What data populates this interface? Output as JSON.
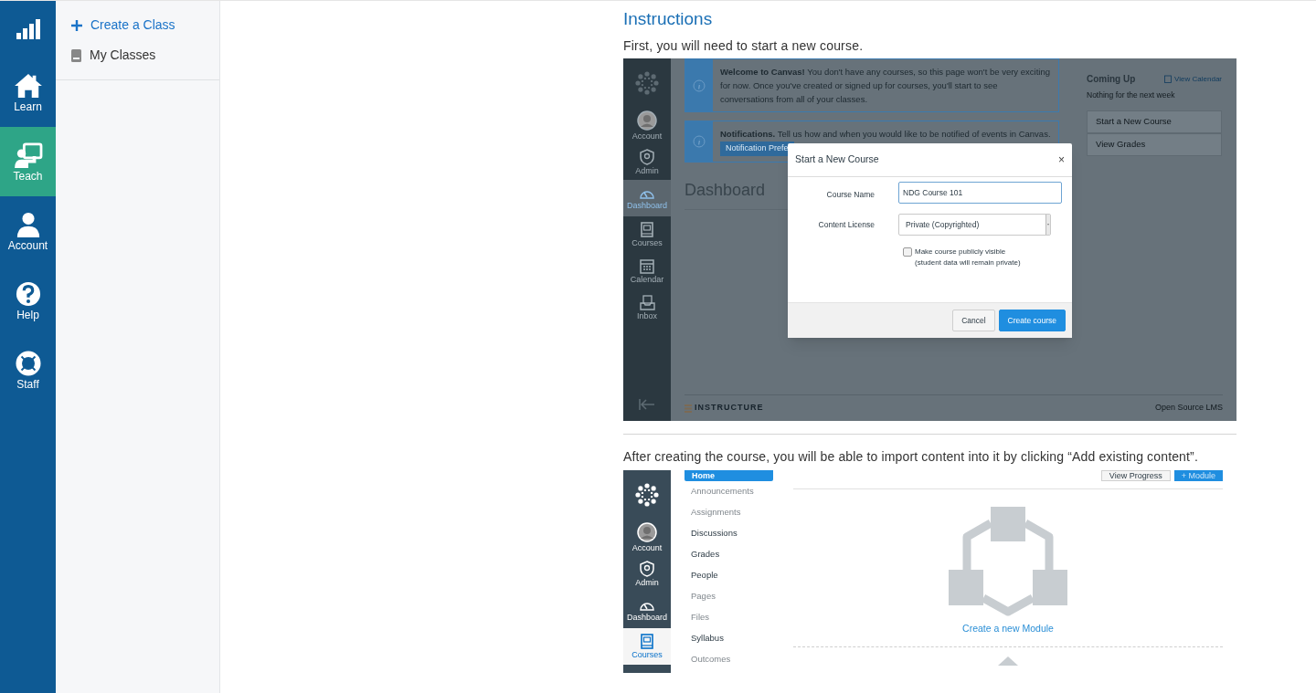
{
  "rail": {
    "items": [
      {
        "label": "Learn",
        "kind": "home",
        "selected": false
      },
      {
        "label": "Teach",
        "kind": "teach",
        "selected": true
      },
      {
        "label": "Account",
        "kind": "user",
        "selected": false
      },
      {
        "label": "Help",
        "kind": "help",
        "selected": false
      },
      {
        "label": "Staff",
        "kind": "lifebuoy",
        "selected": false
      }
    ]
  },
  "sidebar": {
    "items": [
      {
        "label": "Create a Class",
        "kind": "add"
      },
      {
        "label": "My Classes",
        "kind": "book"
      }
    ]
  },
  "content": {
    "heading": "Instructions",
    "intro": "First, you will need to start a new course.",
    "figure_1": {
      "nav": [
        {
          "kind": "logo"
        },
        {
          "label": "Account",
          "kind": "account",
          "selected": false
        },
        {
          "label": "Admin",
          "kind": "admin",
          "selected": false
        },
        {
          "label": "Dashboard",
          "kind": "dashboard",
          "selected": true
        },
        {
          "label": "Courses",
          "kind": "courses",
          "selected": false
        },
        {
          "label": "Calendar",
          "kind": "calendar",
          "selected": false
        },
        {
          "label": "Inbox",
          "kind": "inbox",
          "selected": false
        }
      ],
      "alerts": [
        {
          "text": "**Welcome to Canvas!**  You don't have any courses, so this page won't be very exciting for now. Once you've created or signed up for courses, you'll start to see conversations from all of your classes."
        },
        {
          "text": "**Notifications.**  Tell us how and when you would like to be notified of events in Canvas.",
          "button": "Notification Prefe"
        }
      ],
      "heading": "Dashboard",
      "coming_up": {
        "title": "Coming Up",
        "link": "View Calendar",
        "note": "Nothing for the next week"
      },
      "actions": [
        "Start a New Course",
        "View Grades"
      ],
      "footer": {
        "brand": "INSTRUCTURE",
        "right": "Open Source LMS"
      },
      "dialog": {
        "title": "Start a New Course",
        "close": "×",
        "fields": [
          {
            "kind": "text",
            "label": "Course Name",
            "value": "NDG Course 101"
          },
          {
            "kind": "select",
            "label": "Content License",
            "value": "Private (Copyrighted)"
          },
          {
            "kind": "checkbox",
            "label": "Make course publicly visible",
            "note": "(student data will remain private)",
            "checked": false
          }
        ],
        "buttons": [
          {
            "label": "Cancel",
            "kind": "secondary"
          },
          {
            "label": "Create course",
            "kind": "primary"
          }
        ]
      }
    },
    "outro": "After creating the course, you will be able to import content into it by clicking “Add existing content”.",
    "figure_2": {
      "nav": [
        {
          "kind": "logo"
        },
        {
          "label": "Account",
          "kind": "account",
          "selected": false
        },
        {
          "label": "Admin",
          "kind": "admin",
          "selected": false
        },
        {
          "label": "Dashboard",
          "kind": "dashboard",
          "selected": false
        },
        {
          "label": "Courses",
          "kind": "courses",
          "selected": true
        }
      ],
      "course_nav": [
        {
          "label": "Home",
          "selected": true,
          "hidden": false
        },
        {
          "label": "Announcements",
          "selected": false,
          "hidden": true
        },
        {
          "label": "Assignments",
          "selected": false,
          "hidden": true
        },
        {
          "label": "Discussions",
          "selected": false,
          "hidden": false
        },
        {
          "label": "Grades",
          "selected": false,
          "hidden": false
        },
        {
          "label": "People",
          "selected": false,
          "hidden": false
        },
        {
          "label": "Pages",
          "selected": false,
          "hidden": true
        },
        {
          "label": "Files",
          "selected": false,
          "hidden": true
        },
        {
          "label": "Syllabus",
          "selected": false,
          "hidden": false
        },
        {
          "label": "Outcomes",
          "selected": false,
          "hidden": true
        }
      ],
      "buttons": [
        {
          "label": "View Progress",
          "kind": "secondary"
        },
        {
          "label": "+ Module",
          "kind": "primary"
        }
      ],
      "empty_state": {
        "link": "Create a new Module"
      }
    }
  }
}
